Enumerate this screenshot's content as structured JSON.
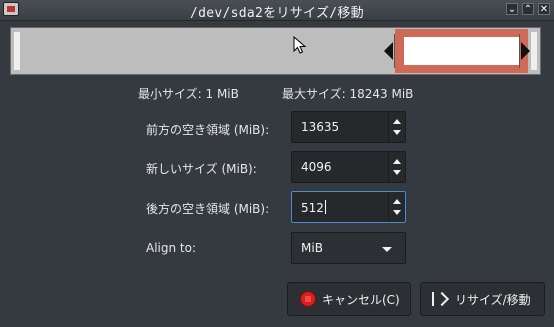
{
  "window": {
    "title": "/dev/sda2をリサイズ/移動",
    "minimize_glyph": "⌄",
    "maximize_glyph": "⌃",
    "close_glyph": "✕"
  },
  "limits": {
    "min_size": "最小サイズ: 1 MiB",
    "max_size": "最大サイズ: 18243 MiB"
  },
  "fields": {
    "free_before_label": "前方の空き領域 (MiB):",
    "free_before_value": "13635",
    "new_size_label": "新しいサイズ (MiB):",
    "new_size_value": "4096",
    "free_after_label": "後方の空き領域 (MiB):",
    "free_after_value": "512",
    "align_label": "Align to:",
    "align_value": "MiB"
  },
  "buttons": {
    "cancel_label": "キャンセル(C)",
    "apply_label": "リサイズ/移動"
  },
  "colors": {
    "partition_border": "#cf6a58",
    "background": "#343a3f"
  }
}
